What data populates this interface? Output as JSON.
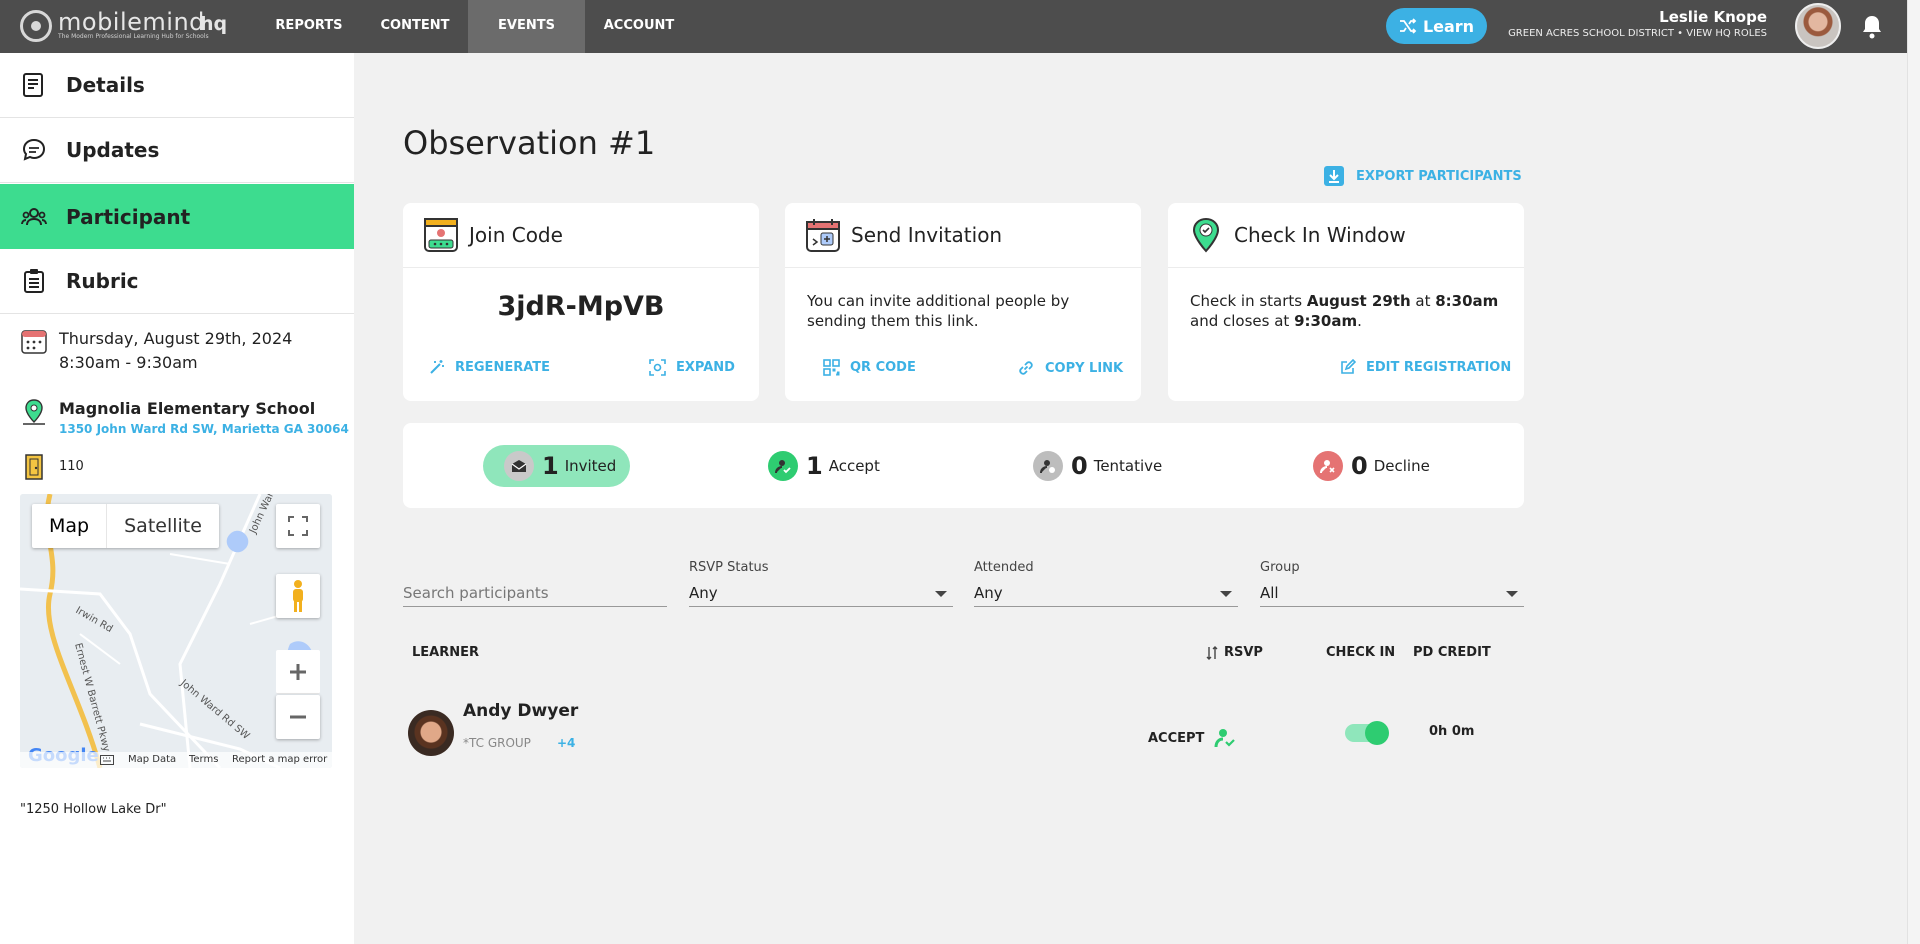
{
  "brand": {
    "name": "mobilemind",
    "tagline": "The Modern Professional Learning Hub for Schools",
    "suffix": "hq"
  },
  "nav": {
    "items": [
      {
        "label": "REPORTS",
        "active": false
      },
      {
        "label": "CONTENT",
        "active": false
      },
      {
        "label": "EVENTS",
        "active": true
      },
      {
        "label": "ACCOUNT",
        "active": false
      }
    ]
  },
  "learn_button": {
    "label": "Learn",
    "icon": "shuffle-icon",
    "color": "#3cb1e4"
  },
  "user": {
    "name": "Leslie Knope",
    "subtitle": "GREEN ACRES SCHOOL DISTRICT • VIEW HQ ROLES"
  },
  "sidebar": {
    "items": [
      {
        "label": "Details",
        "icon": "details-icon",
        "active": false
      },
      {
        "label": "Updates",
        "icon": "chat-bubble-icon",
        "active": false
      },
      {
        "label": "Participant",
        "icon": "people-icon",
        "active": true
      },
      {
        "label": "Rubric",
        "icon": "clipboard-icon",
        "active": false
      }
    ],
    "date": {
      "day": "Thursday, August 29th, 2024",
      "time": "8:30am - 9:30am"
    },
    "location": {
      "name": "Magnolia Elementary School",
      "address": "1350 John Ward Rd SW, Marietta GA 30064"
    },
    "room": "110",
    "map": {
      "type_map": "Map",
      "type_satellite": "Satellite",
      "footer": {
        "data": "Map Data",
        "terms": "Terms",
        "report": "Report a map error"
      },
      "logo": "Google",
      "roads": [
        "Irwin Rd",
        "John Ward Rd",
        "John Ward Rd SW",
        "Ernest W Barrett Pkwy"
      ]
    },
    "extra_address": "\"1250 Hollow Lake Dr\""
  },
  "page": {
    "title": "Observation #1",
    "export_label": "EXPORT PARTICIPANTS"
  },
  "cards": {
    "join": {
      "title": "Join Code",
      "code": "3jdR-MpVB",
      "regenerate": "REGENERATE",
      "expand": "EXPAND"
    },
    "invite": {
      "title": "Send Invitation",
      "body": "You can invite additional people by sending them this link.",
      "qr": "QR CODE",
      "copy": "COPY LINK"
    },
    "checkin": {
      "title": "Check In Window",
      "prefix": "Check in starts ",
      "date": "August 29th",
      "at": " at ",
      "start": "8:30am",
      "and": " and closes at ",
      "end": "9:30am",
      "period": ".",
      "edit": "EDIT REGISTRATION"
    }
  },
  "stats": [
    {
      "count": "1",
      "label": "Invited",
      "color": "#8fe6bb"
    },
    {
      "count": "1",
      "label": "Accept",
      "color": "#2ecc71"
    },
    {
      "count": "0",
      "label": "Tentative",
      "color": "#9a9a9a"
    },
    {
      "count": "0",
      "label": "Decline",
      "color": "#e57373"
    }
  ],
  "filters": {
    "search_placeholder": "Search participants",
    "rsvp": {
      "label": "RSVP Status",
      "value": "Any"
    },
    "attended": {
      "label": "Attended",
      "value": "Any"
    },
    "group": {
      "label": "Group",
      "value": "All"
    }
  },
  "table": {
    "headers": {
      "learner": "LEARNER",
      "rsvp": "RSVP",
      "checkin": "CHECK IN",
      "credit": "PD CREDIT"
    },
    "rows": [
      {
        "name": "Andy Dwyer",
        "group": "*TC GROUP",
        "more": "+4",
        "rsvp": "ACCEPT",
        "checked_in": true,
        "credit": "0h 0m"
      }
    ]
  }
}
